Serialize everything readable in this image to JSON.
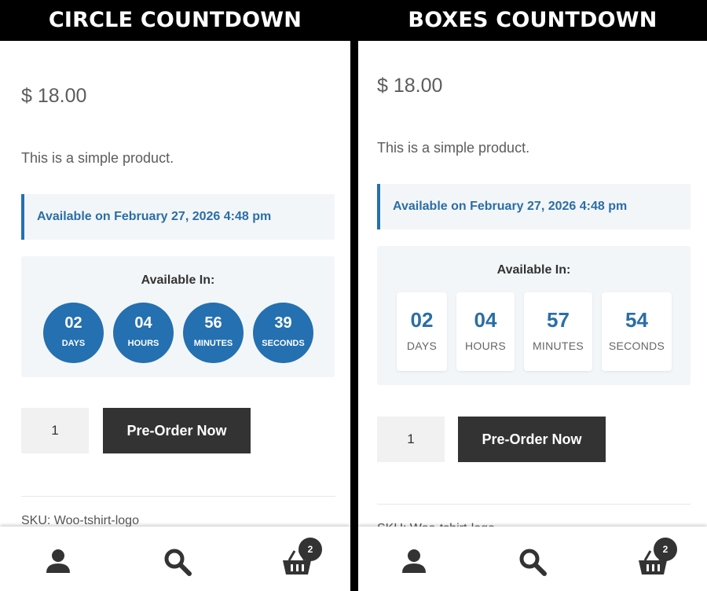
{
  "panels": {
    "circle": {
      "header": "CIRCLE COUNTDOWN",
      "price": "$ 18.00",
      "description": "This is a simple product.",
      "availability": "Available on February 27, 2026 4:48 pm",
      "countdown_title": "Available In:",
      "countdown": {
        "days": {
          "value": "02",
          "label": "DAYS"
        },
        "hours": {
          "value": "04",
          "label": "HOURS"
        },
        "minutes": {
          "value": "56",
          "label": "MINUTES"
        },
        "seconds": {
          "value": "39",
          "label": "SECONDS"
        }
      },
      "quantity": "1",
      "preorder_label": "Pre-Order Now",
      "sku": "SKU: Woo-tshirt-logo",
      "cart_count": "2"
    },
    "boxes": {
      "header": "BOXES COUNTDOWN",
      "price": "$ 18.00",
      "description": "This is a simple product.",
      "availability": "Available on February 27, 2026 4:48 pm",
      "countdown_title": "Available In:",
      "countdown": {
        "days": {
          "value": "02",
          "label": "DAYS"
        },
        "hours": {
          "value": "04",
          "label": "HOURS"
        },
        "minutes": {
          "value": "57",
          "label": "MINUTES"
        },
        "seconds": {
          "value": "54",
          "label": "SECONDS"
        }
      },
      "quantity": "1",
      "preorder_label": "Pre-Order Now",
      "sku": "SKU: Woo-tshirt-logo",
      "cart_count": "2"
    }
  },
  "bottom_nav": {
    "icons": [
      "user-icon",
      "search-icon",
      "basket-icon"
    ]
  },
  "colors": {
    "accent": "#2470b0",
    "button": "#333333",
    "banner_bg": "#f3f6f9"
  }
}
